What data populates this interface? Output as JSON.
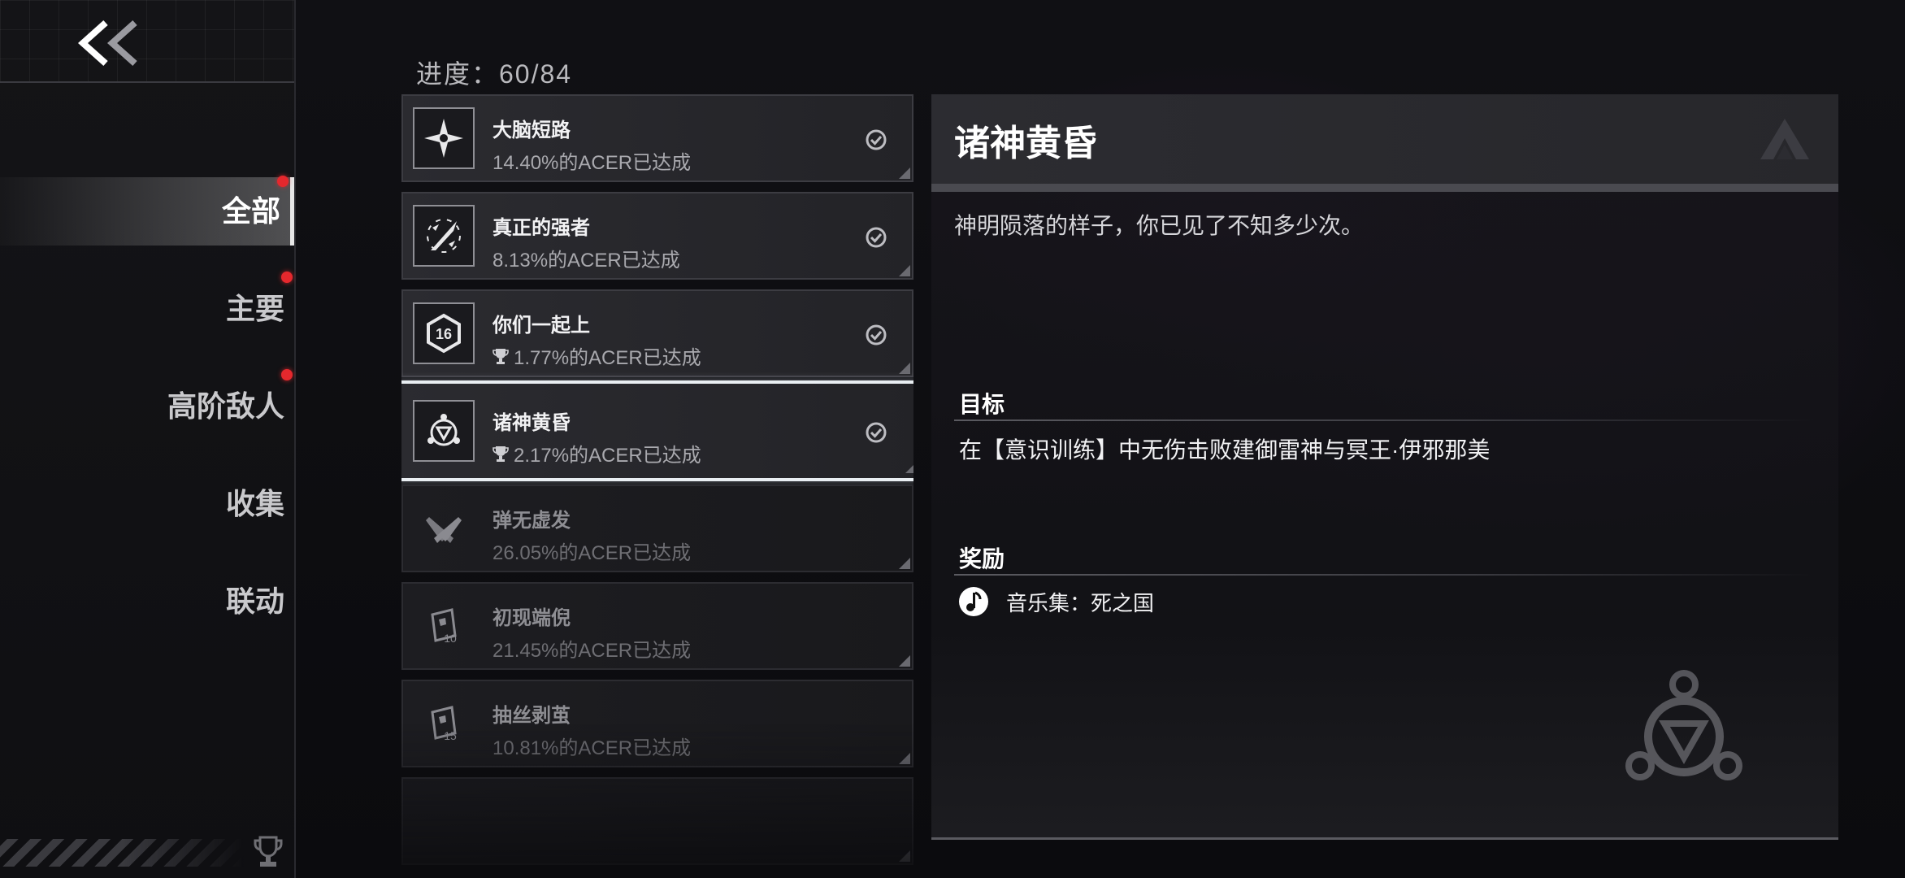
{
  "sidebar": {
    "items": [
      {
        "label": "全部",
        "active": true,
        "badge": true
      },
      {
        "label": "主要",
        "active": false,
        "badge": true
      },
      {
        "label": "高阶敌人",
        "active": false,
        "badge": true
      },
      {
        "label": "收集",
        "active": false,
        "badge": false
      },
      {
        "label": "联动",
        "active": false,
        "badge": false
      }
    ]
  },
  "progress": {
    "label": "进度：60/84"
  },
  "achievements": [
    {
      "title": "大脑短路",
      "percent_text": "14.40%的ACER已达成",
      "completed": true,
      "trophy": false,
      "icon": "shuriken-icon"
    },
    {
      "title": "真正的强者",
      "percent_text": "8.13%的ACER已达成",
      "completed": true,
      "trophy": false,
      "icon": "crossed-blades-icon"
    },
    {
      "title": "你们一起上",
      "percent_text": "1.77%的ACER已达成",
      "completed": true,
      "trophy": true,
      "icon": "hexagon-16-icon"
    },
    {
      "title": "诸神黄昏",
      "percent_text": "2.17%的ACER已达成",
      "completed": true,
      "trophy": true,
      "icon": "trinity-emblem-icon",
      "selected": true
    },
    {
      "title": "弹无虚发",
      "percent_text": "26.05%的ACER已达成",
      "completed": false,
      "trophy": false,
      "icon": "crossed-pistols-icon"
    },
    {
      "title": "初现端倪",
      "percent_text": "21.45%的ACER已达成",
      "completed": false,
      "trophy": false,
      "icon": "card-10-icon"
    },
    {
      "title": "抽丝剥茧",
      "percent_text": "10.81%的ACER已达成",
      "completed": false,
      "trophy": false,
      "icon": "card-15-icon"
    }
  ],
  "detail": {
    "title": "诸神黄昏",
    "description": "神明陨落的样子，你已见了不知多少次。",
    "goal_label": "目标",
    "goal_text": "在【意识训练】中无伤击败建御雷神与冥王·伊邪那美",
    "reward_label": "奖励",
    "reward_text": "音乐集：死之国"
  },
  "colors": {
    "accent_red": "#e5282d",
    "selected_border": "#e9eef2"
  }
}
